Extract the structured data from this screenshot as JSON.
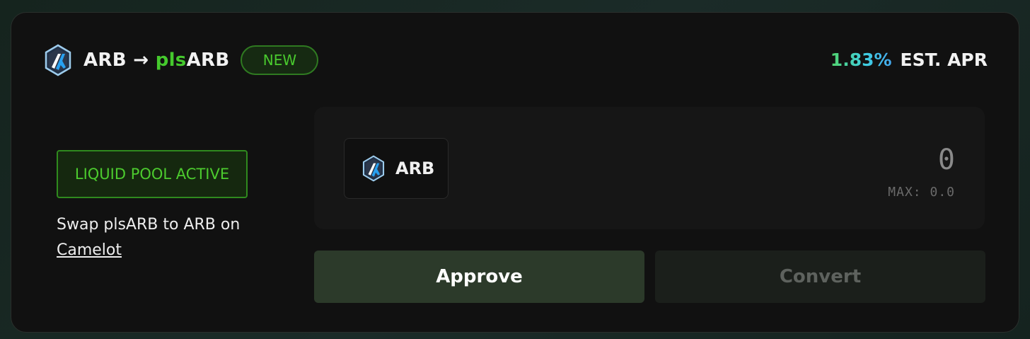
{
  "header": {
    "from_token": "ARB",
    "arrow": "→",
    "to_prefix": "pls",
    "to_suffix": "ARB",
    "badge": "NEW"
  },
  "apr": {
    "value": "1.83%",
    "label": "EST. APR"
  },
  "left_panel": {
    "liquid_badge": "LIQUID POOL ACTIVE",
    "swap_text": "Swap plsARB to ARB on",
    "swap_link": "Camelot"
  },
  "input": {
    "token": "ARB",
    "amount": "0",
    "max_label": "MAX: 0.0"
  },
  "buttons": {
    "approve": "Approve",
    "convert": "Convert"
  },
  "icons": {
    "arbitrum": "arbitrum-logo-icon"
  },
  "colors": {
    "accent_green": "#45c92d",
    "apr_gradient_start": "#52d36a",
    "apr_gradient_end": "#45a8f0",
    "card_bg": "#111111",
    "approve_bg": "#2c3a2a",
    "convert_bg": "#1b1f1b"
  }
}
